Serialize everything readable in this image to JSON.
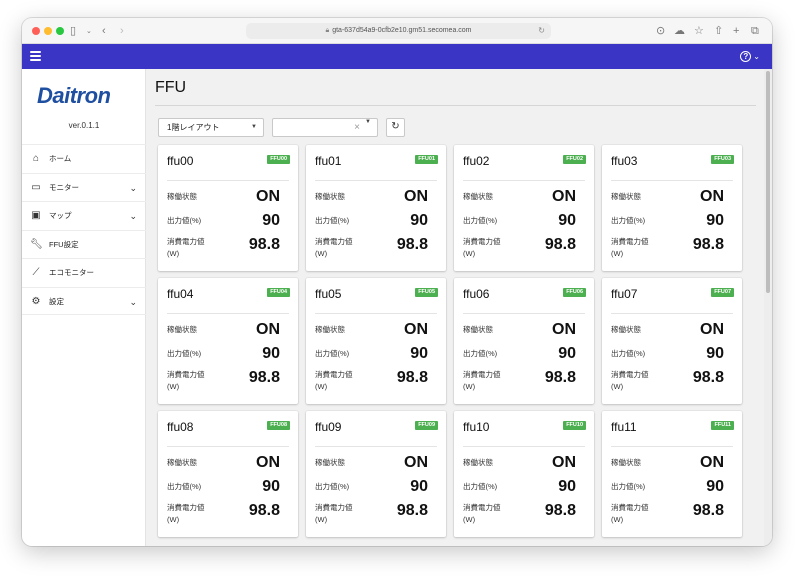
{
  "browser": {
    "url": "gta-637d54a9-0cfb2e10.gm51.secomea.com"
  },
  "sidebar": {
    "logo": "Daitron",
    "version": "ver.0.1.1",
    "items": [
      {
        "label": "ホーム",
        "icon": "home-icon",
        "chevron": false
      },
      {
        "label": "モニター",
        "icon": "monitor-icon",
        "chevron": true
      },
      {
        "label": "マップ",
        "icon": "image-icon",
        "chevron": true
      },
      {
        "label": "FFU設定",
        "icon": "wrench-icon",
        "chevron": false
      },
      {
        "label": "エコモニター",
        "icon": "trend-chart-icon",
        "chevron": false
      },
      {
        "label": "設定",
        "icon": "gear-icon",
        "chevron": true
      }
    ]
  },
  "main": {
    "title": "FFU",
    "layout_select": {
      "value": "1階レイアウト"
    },
    "filter_select": {
      "value": ""
    },
    "labels": {
      "status": "稼働状態",
      "output": "出力値(%)",
      "power_line1": "消費電力値",
      "power_line2": "(W)"
    },
    "cards": [
      {
        "name": "ffu00",
        "badge": "FFU00",
        "status": "ON",
        "output": "90",
        "power": "98.8"
      },
      {
        "name": "ffu01",
        "badge": "FFU01",
        "status": "ON",
        "output": "90",
        "power": "98.8"
      },
      {
        "name": "ffu02",
        "badge": "FFU02",
        "status": "ON",
        "output": "90",
        "power": "98.8"
      },
      {
        "name": "ffu03",
        "badge": "FFU03",
        "status": "ON",
        "output": "90",
        "power": "98.8"
      },
      {
        "name": "ffu04",
        "badge": "FFU04",
        "status": "ON",
        "output": "90",
        "power": "98.8"
      },
      {
        "name": "ffu05",
        "badge": "FFU05",
        "status": "ON",
        "output": "90",
        "power": "98.8"
      },
      {
        "name": "ffu06",
        "badge": "FFU06",
        "status": "ON",
        "output": "90",
        "power": "98.8"
      },
      {
        "name": "ffu07",
        "badge": "FFU07",
        "status": "ON",
        "output": "90",
        "power": "98.8"
      },
      {
        "name": "ffu08",
        "badge": "FFU08",
        "status": "ON",
        "output": "90",
        "power": "98.8"
      },
      {
        "name": "ffu09",
        "badge": "FFU09",
        "status": "ON",
        "output": "90",
        "power": "98.8"
      },
      {
        "name": "ffu10",
        "badge": "FFU10",
        "status": "ON",
        "output": "90",
        "power": "98.8"
      },
      {
        "name": "ffu11",
        "badge": "FFU11",
        "status": "ON",
        "output": "90",
        "power": "98.8"
      }
    ]
  },
  "colors": {
    "appbar": "#3a35c4",
    "logo": "#1f4fa0",
    "badge": "#4caf50"
  }
}
